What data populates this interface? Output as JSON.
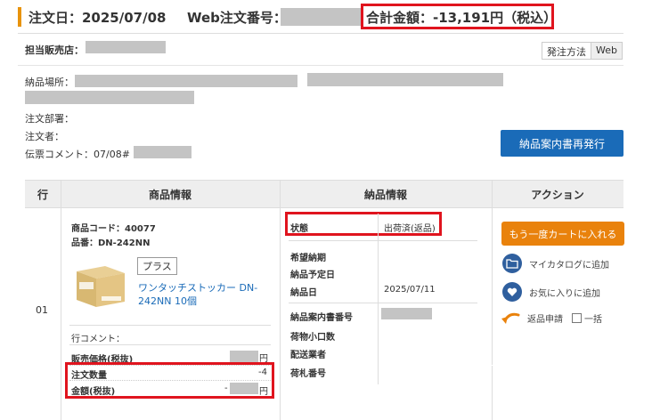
{
  "header": {
    "order_date_label": "注文日：2025/07/08",
    "web_order_label": "Web注文番号：",
    "total_label": "合計金額：-13,191円（税込）"
  },
  "info": {
    "store_label": "担当販売店：",
    "method_key": "発注方法",
    "method_value": "Web",
    "delivery_place_label": "納品場所：",
    "dept_label": "注文部署：",
    "orderer_label": "注文者：",
    "comment_label": "伝票コメント：07/08#",
    "reissue_button": "納品案内書再発行"
  },
  "table": {
    "headers": [
      "行",
      "商品情報",
      "納品情報",
      "アクション"
    ],
    "row_no": "01",
    "product": {
      "code": "商品コード：40077",
      "part_no": "品番：DN-242NN",
      "tag": "プラス",
      "name": "ワンタッチストッカー DN-242NN 10個",
      "line_comment": "行コメント：",
      "price_label": "販売価格(税抜)",
      "price_unit": "円",
      "qty_label": "注文数量",
      "qty_value": "-4",
      "amount_label": "金額(税抜)",
      "amount_prefix": "-",
      "amount_unit": "円"
    },
    "delivery": {
      "status_label": "状態",
      "status_value": "出荷済(返品)",
      "desired_label": "希望納期",
      "planned_label": "納品予定日",
      "delivered_label": "納品日",
      "delivered_value": "2025/07/11",
      "guide_no_label": "納品案内書番号",
      "parcels_label": "荷物小口数",
      "carrier_label": "配送業者",
      "tag_no_label": "荷札番号"
    },
    "actions": {
      "reorder_button": "もう一度カートに入れる",
      "catalog_label": "マイカタログに追加",
      "favorite_label": "お気に入りに追加",
      "return_label": "返品申請",
      "bulk_label": "一括"
    }
  },
  "colors": {
    "accent_orange": "#e9820c",
    "button_blue": "#1a6bb8",
    "highlight_red": "#e0141e",
    "redaction_gray": "#c4c4c4"
  }
}
